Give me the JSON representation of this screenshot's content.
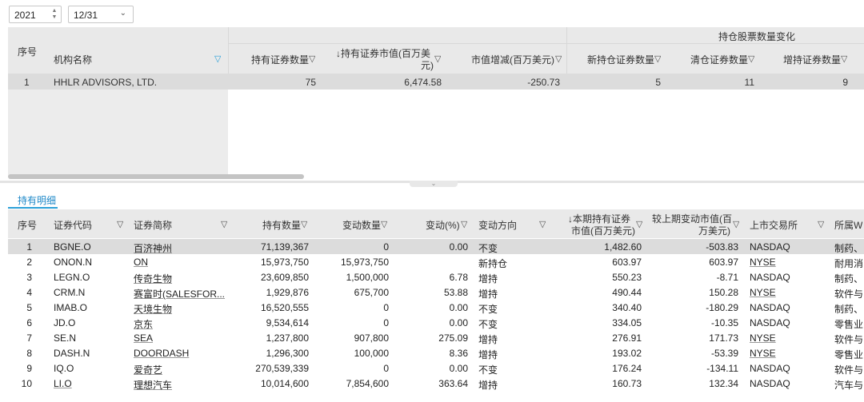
{
  "controls": {
    "year": "2021",
    "date": "12/31"
  },
  "top_table": {
    "headers": {
      "seq": "序号",
      "name": "机构名称",
      "hold_count": "持有证券数量",
      "hold_value_line1": "↓持有证券市值(百万美",
      "hold_value_line2": "元)",
      "value_change": "市值增减(百万美元)",
      "group": "持仓股票数量变化",
      "new_count": "新持仓证券数量",
      "clear_count": "清仓证券数量",
      "add_count": "增持证券数量"
    },
    "row": {
      "seq": "1",
      "name": "HHLR ADVISORS, LTD.",
      "hold_count": "75",
      "hold_value": "6,474.58",
      "value_change": "-250.73",
      "new_count": "5",
      "clear_count": "11",
      "add_count": "9"
    }
  },
  "tab_label": "持有明细",
  "bottom_table": {
    "headers": {
      "seq": "序号",
      "code": "证券代码",
      "short": "证券简称",
      "qty": "持有数量",
      "chg_qty": "变动数量",
      "chg_pct": "变动(%)",
      "dir": "变动方向",
      "mv_line1": "↓本期持有证券",
      "mv_line2": "市值(百万美元)",
      "mv_chg_line1": "较上期变动市值(百",
      "mv_chg_line2": "万美元)",
      "exchange": "上市交易所",
      "industry": "所属W"
    },
    "rows": [
      {
        "seq": "1",
        "code": "BGNE.O",
        "short": "百济神州",
        "qty": "71,139,367",
        "chg_qty": "0",
        "chg_pct": "0.00",
        "dir": "不变",
        "mv": "1,482.60",
        "mv_chg": "-503.83",
        "exchange": "NASDAQ",
        "industry": "制药、"
      },
      {
        "seq": "2",
        "code": "ONON.N",
        "short": "ON",
        "qty": "15,973,750",
        "chg_qty": "15,973,750",
        "chg_pct": "",
        "dir": "新持仓",
        "mv": "603.97",
        "mv_chg": "603.97",
        "exchange": "NYSE",
        "industry": "耐用消"
      },
      {
        "seq": "3",
        "code": "LEGN.O",
        "short": "传奇生物",
        "qty": "23,609,850",
        "chg_qty": "1,500,000",
        "chg_pct": "6.78",
        "dir": "增持",
        "mv": "550.23",
        "mv_chg": "-8.71",
        "exchange": "NASDAQ",
        "industry": "制药、"
      },
      {
        "seq": "4",
        "code": "CRM.N",
        "short": "赛富时(SALESFOR...",
        "qty": "1,929,876",
        "chg_qty": "675,700",
        "chg_pct": "53.88",
        "dir": "增持",
        "mv": "490.44",
        "mv_chg": "150.28",
        "exchange": "NYSE",
        "industry": "软件与"
      },
      {
        "seq": "5",
        "code": "IMAB.O",
        "short": "天境生物",
        "qty": "16,520,555",
        "chg_qty": "0",
        "chg_pct": "0.00",
        "dir": "不变",
        "mv": "340.40",
        "mv_chg": "-180.29",
        "exchange": "NASDAQ",
        "industry": "制药、"
      },
      {
        "seq": "6",
        "code": "JD.O",
        "short": "京东",
        "qty": "9,534,614",
        "chg_qty": "0",
        "chg_pct": "0.00",
        "dir": "不变",
        "mv": "334.05",
        "mv_chg": "-10.35",
        "exchange": "NASDAQ",
        "industry": "零售业"
      },
      {
        "seq": "7",
        "code": "SE.N",
        "short": "SEA",
        "qty": "1,237,800",
        "chg_qty": "907,800",
        "chg_pct": "275.09",
        "dir": "增持",
        "mv": "276.91",
        "mv_chg": "171.73",
        "exchange": "NYSE",
        "industry": "软件与"
      },
      {
        "seq": "8",
        "code": "DASH.N",
        "short": "DOORDASH",
        "qty": "1,296,300",
        "chg_qty": "100,000",
        "chg_pct": "8.36",
        "dir": "增持",
        "mv": "193.02",
        "mv_chg": "-53.39",
        "exchange": "NYSE",
        "industry": "零售业"
      },
      {
        "seq": "9",
        "code": "IQ.O",
        "short": "爱奇艺",
        "qty": "270,539,339",
        "chg_qty": "0",
        "chg_pct": "0.00",
        "dir": "不变",
        "mv": "176.24",
        "mv_chg": "-134.11",
        "exchange": "NASDAQ",
        "industry": "软件与"
      },
      {
        "seq": "10",
        "code": "LI.O",
        "short": "理想汽车",
        "qty": "10,014,600",
        "chg_qty": "7,854,600",
        "chg_pct": "363.64",
        "dir": "增持",
        "mv": "160.73",
        "mv_chg": "132.34",
        "exchange": "NASDAQ",
        "industry": "汽车与"
      }
    ]
  },
  "colors": {
    "accent": "#2ba0d8",
    "header_bg": "#e9e9e9",
    "selected_row_bg": "#dcdcdc"
  }
}
